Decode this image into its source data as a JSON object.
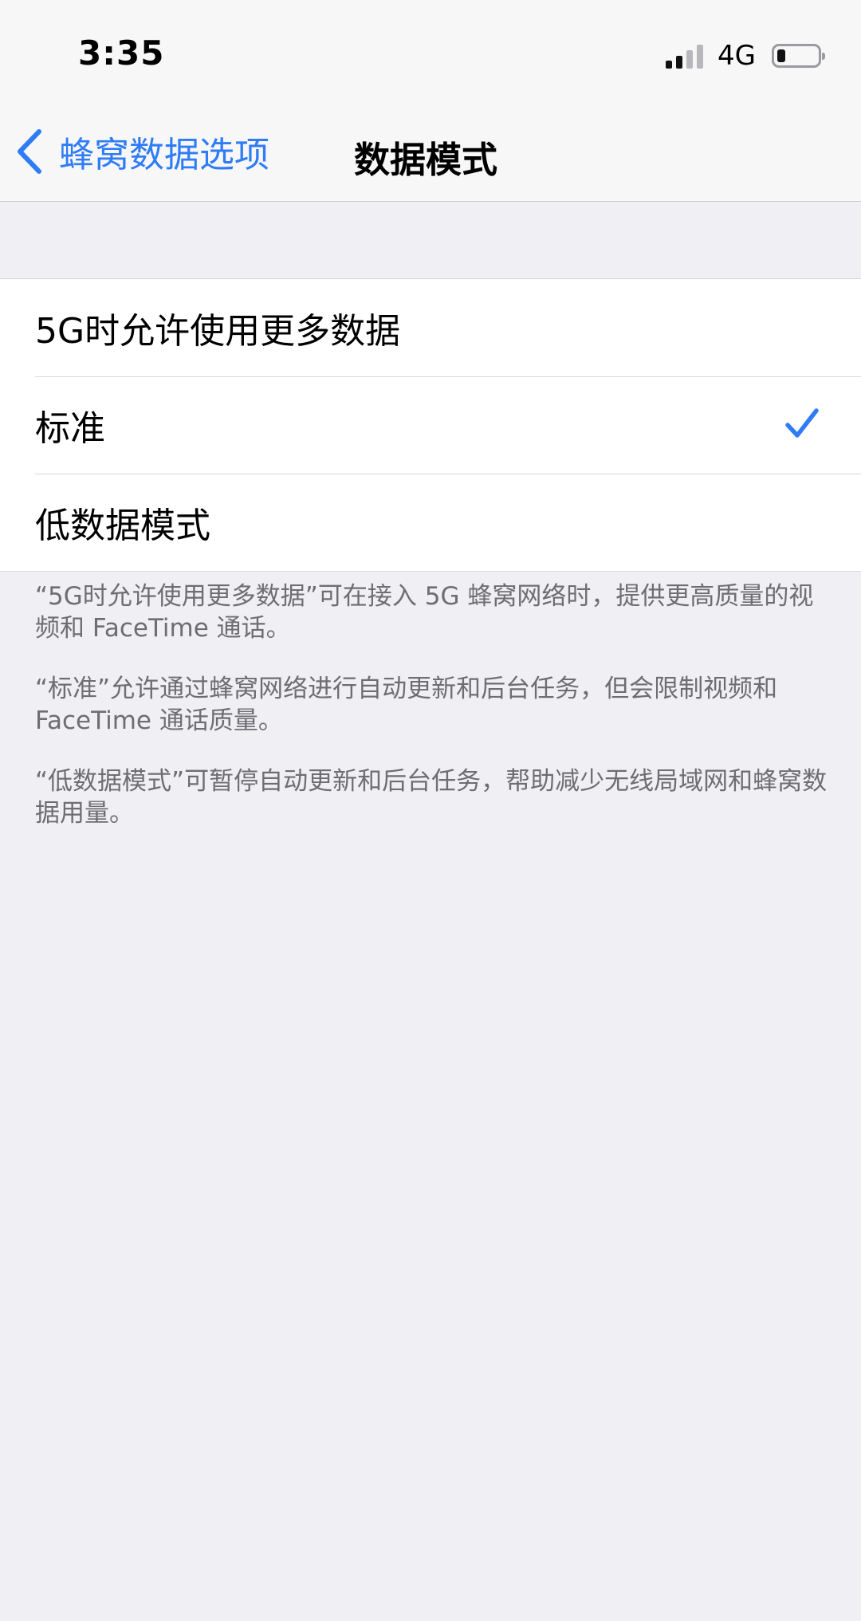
{
  "status_bar": {
    "time": "3:35",
    "network": "4G",
    "signal_bars": 4,
    "signal_active_bars": 2,
    "battery_level": 0.2
  },
  "nav": {
    "back_label": "蜂窝数据选项",
    "title": "数据模式",
    "back_icon": "chevron-left-icon"
  },
  "options": [
    {
      "label": "5G时允许使用更多数据",
      "selected": false
    },
    {
      "label": "标准",
      "selected": true
    },
    {
      "label": "低数据模式",
      "selected": false
    }
  ],
  "footer": {
    "paragraphs": [
      "“5G时允许使用更多数据”可在接入 5G 蜂窝网络时，提供更高质量的视频和 FaceTime 通话。",
      "“标准”允许通过蜂窝网络进行自动更新和后台任务，但会限制视频和 FaceTime 通话质量。",
      "“低数据模式”可暂停自动更新和后台任务，帮助减少无线局域网和蜂窝数据用量。"
    ]
  },
  "colors": {
    "accent": "#2f7cf6",
    "background": "#efeff4",
    "footer_text": "#6d6d72"
  }
}
